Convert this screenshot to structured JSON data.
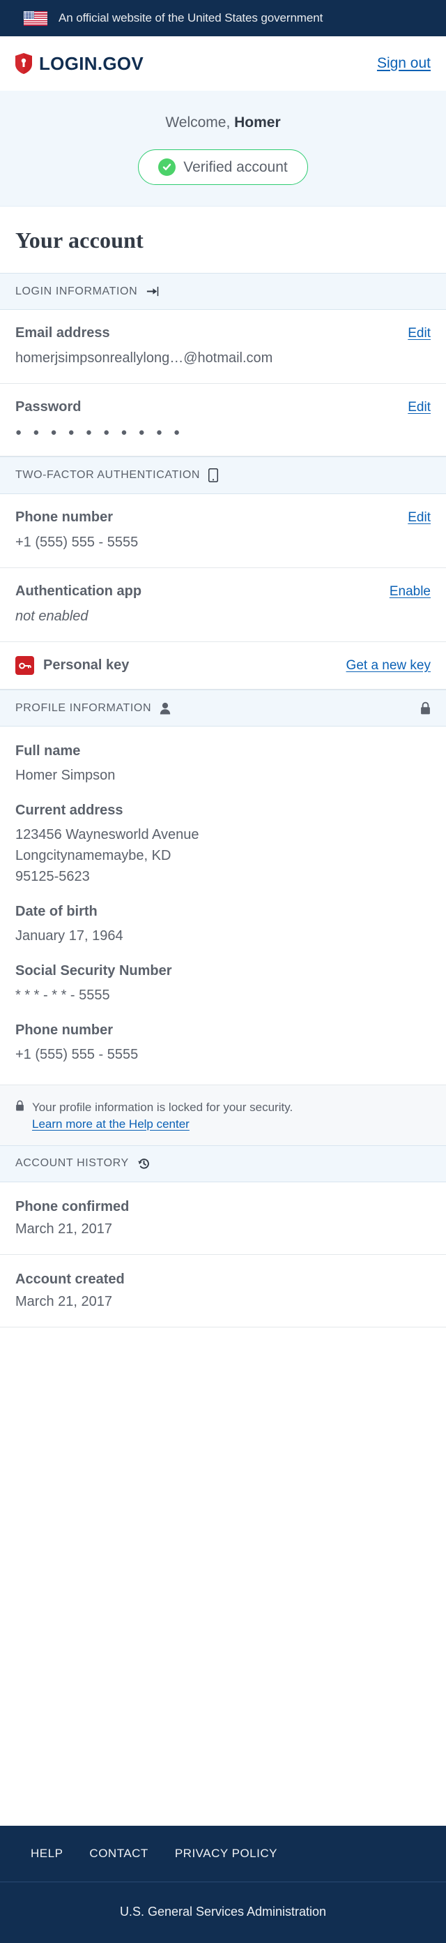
{
  "banner": {
    "text": "An official website of the United States government",
    "flag_icon": "us-flag-icon",
    "bg_color": "#112e51"
  },
  "header": {
    "brand": "LOGIN.GOV",
    "brand_icon": "shield-lock-icon",
    "signout_label": "Sign out",
    "link_color": "#0b61b5"
  },
  "welcome": {
    "greeting": "Welcome, ",
    "name": "Homer",
    "badge_label": "Verified account",
    "badge_icon": "circle-check-icon",
    "badge_color": "#2ecc71"
  },
  "page_title": "Your account",
  "sections": {
    "login_information": {
      "title": "LOGIN INFORMATION",
      "icon": "sign-in-arrow-icon",
      "rows": [
        {
          "label": "Email address",
          "value": "homerjsimpsonreallylong…@hotmail.com",
          "action": "Edit"
        },
        {
          "label": "Password",
          "value": "● ● ● ● ● ● ● ● ● ●",
          "action": "Edit"
        }
      ]
    },
    "two_factor": {
      "title": "TWO-FACTOR AUTHENTICATION",
      "icon": "mobile-phone-icon",
      "rows": [
        {
          "label": "Phone number",
          "value": "+1 (555) 555 - 5555",
          "action": "Edit"
        },
        {
          "label": "Authentication app",
          "value": "not enabled",
          "action": "Enable"
        }
      ],
      "personal_key": {
        "label": "Personal key",
        "icon": "key-icon",
        "icon_color": "#cd2026",
        "action": "Get a new key"
      }
    },
    "profile_information": {
      "title": "PROFILE INFORMATION",
      "icon": "person-icon",
      "lock_icon": "lock-icon",
      "fields": [
        {
          "label": "Full name",
          "value": "Homer Simpson"
        },
        {
          "label": "Current address",
          "value": "123456 Waynesworld Avenue\nLongcitynamemaybe, KD\n95125-5623"
        },
        {
          "label": "Date of birth",
          "value": "January 17, 1964"
        },
        {
          "label": "Social Security Number",
          "value": "* * * - * * - 5555"
        },
        {
          "label": "Phone number",
          "value": "+1 (555) 555 - 5555"
        }
      ],
      "notice": {
        "icon": "lock-icon",
        "text": "Your profile information is locked for your security.",
        "link": "Learn more at the Help center"
      }
    },
    "account_history": {
      "title": "ACCOUNT HISTORY",
      "icon": "history-clock-icon",
      "events": [
        {
          "title": "Phone confirmed",
          "date": "March 21, 2017"
        },
        {
          "title": "Account created",
          "date": "March 21, 2017"
        }
      ]
    }
  },
  "footer": {
    "links": [
      "HELP",
      "CONTACT",
      "PRIVACY POLICY"
    ],
    "agency": "U.S. General Services Administration",
    "bg_color": "#112e51"
  }
}
